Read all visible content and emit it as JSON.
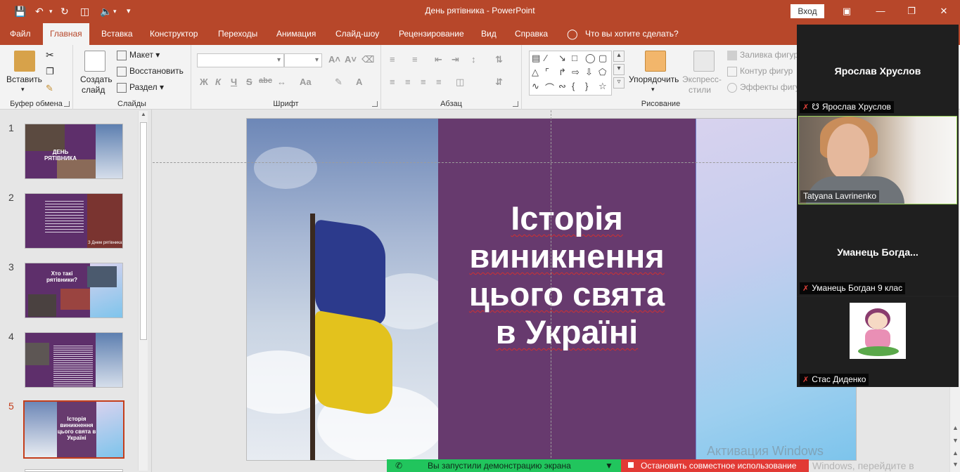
{
  "app": {
    "title": "День рятівника  -  PowerPoint",
    "sign_in": "Вход"
  },
  "tabs": [
    {
      "label": "Файл",
      "active": false
    },
    {
      "label": "Главная",
      "active": true
    },
    {
      "label": "Вставка",
      "active": false
    },
    {
      "label": "Конструктор",
      "active": false
    },
    {
      "label": "Переходы",
      "active": false
    },
    {
      "label": "Анимация",
      "active": false
    },
    {
      "label": "Слайд-шоу",
      "active": false
    },
    {
      "label": "Рецензирование",
      "active": false
    },
    {
      "label": "Вид",
      "active": false
    },
    {
      "label": "Справка",
      "active": false
    }
  ],
  "tell_me": "Что вы хотите сделать?",
  "ribbon": {
    "clipboard": {
      "paste": "Вставить",
      "label": "Буфер обмена"
    },
    "slides": {
      "new_slide_1": "Создать",
      "new_slide_2": "слайд",
      "layout": "Макет",
      "reset": "Восстановить",
      "section": "Раздел",
      "label": "Слайды"
    },
    "font": {
      "label": "Шрифт",
      "bold": "Ж",
      "italic": "К",
      "underline": "Ч",
      "strike": "S",
      "abc": "abc",
      "aa": "Aa",
      "fontcolor": "A"
    },
    "paragraph": {
      "label": "Абзац"
    },
    "drawing": {
      "arrange": "Упорядочить",
      "quick_styles_1": "Экспресс-",
      "quick_styles_2": "стили",
      "fill": "Заливка фигур",
      "outline": "Контур фигур",
      "effects": "Эффекты фигур",
      "label": "Рисование"
    }
  },
  "thumbnails": [
    {
      "num": "1",
      "selected": false,
      "caption": "ДЕНЬ РЯТІВНИКА"
    },
    {
      "num": "2",
      "selected": false,
      "caption": "З Днем рятівника!"
    },
    {
      "num": "3",
      "selected": false,
      "caption": "Хто такі рятівники?"
    },
    {
      "num": "4",
      "selected": false,
      "caption": ""
    },
    {
      "num": "5",
      "selected": true,
      "caption": "Історія виникнення цього свята в Україні"
    }
  ],
  "slide": {
    "title_lines": [
      "Історія",
      "виникнення",
      "цього свята",
      "в Україні"
    ]
  },
  "call": {
    "participants": [
      {
        "big_name": "Ярослав Хруслов",
        "label": "Ярослав Хруслов",
        "muted": true,
        "pinned": true,
        "video": false
      },
      {
        "big_name": "",
        "label": "Tatyana Lavrinenko",
        "muted": false,
        "pinned": false,
        "video": true
      },
      {
        "big_name": "Уманець  Богда...",
        "label": "Уманець Богдан 9 клас",
        "muted": true,
        "pinned": false,
        "video": false
      },
      {
        "big_name": "",
        "label": "Стас Диденко",
        "muted": true,
        "pinned": false,
        "video": false,
        "avatar": true
      }
    ]
  },
  "share": {
    "started": "Вы запустили демонстрацию экрана",
    "stop": "Остановить совместное использование"
  },
  "watermark": {
    "line1": "Активация Windows",
    "line2": "Windows, перейдите в"
  },
  "colors": {
    "accent": "#b7472a",
    "slide_purple": "#673a6e",
    "share_green": "#21c55d",
    "share_red": "#e23a35"
  }
}
